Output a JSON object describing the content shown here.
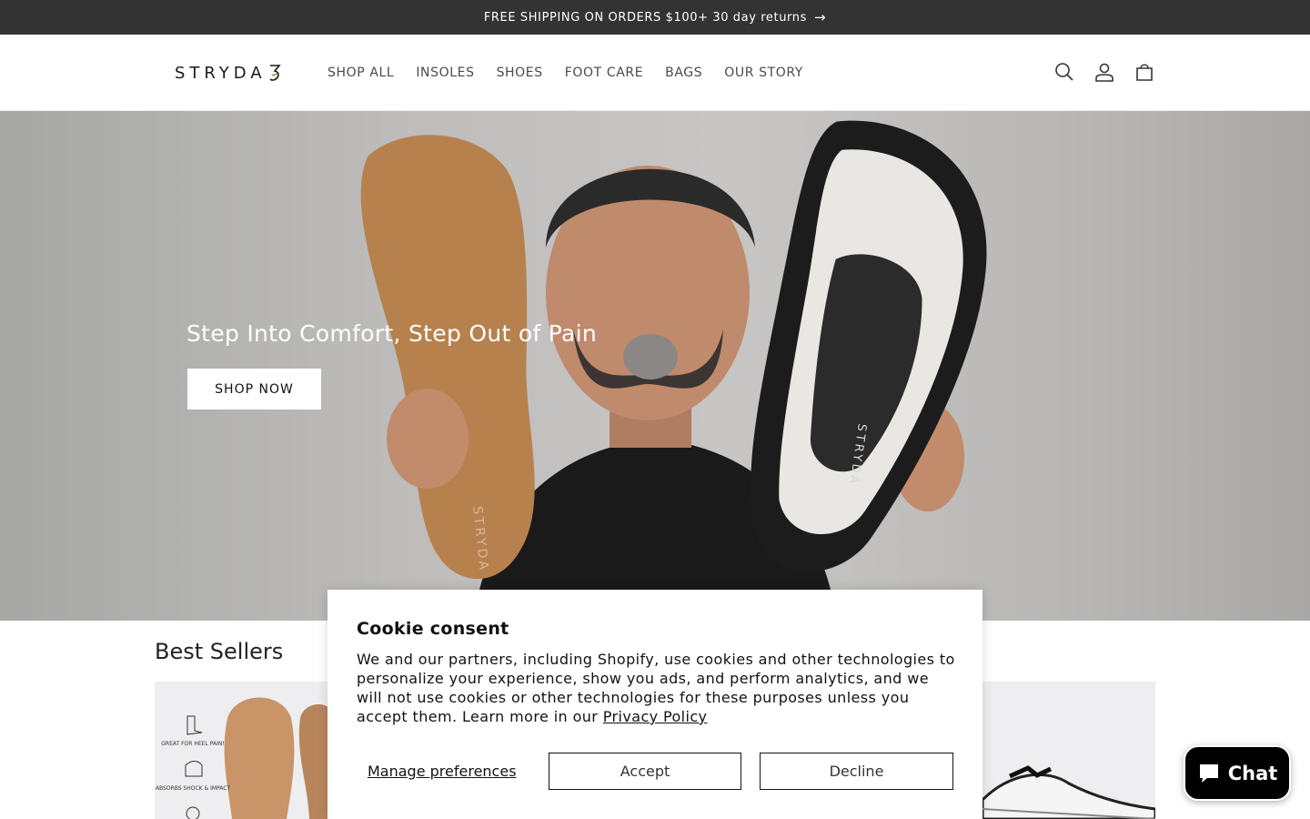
{
  "announcement": {
    "text": "FREE SHIPPING ON ORDERS $100+ 30 day returns",
    "arrow": "→"
  },
  "header": {
    "logo_text": "STRYDA",
    "nav": [
      "SHOP ALL",
      "INSOLES",
      "SHOES",
      "FOOT CARE",
      "BAGS",
      "OUR STORY"
    ],
    "icons": [
      "search-icon",
      "account-icon",
      "cart-icon"
    ]
  },
  "hero": {
    "title": "Step Into Comfort, Step Out of Pain",
    "button": "SHOP NOW",
    "insole_brand": "STRYDA",
    "shoe_brand": "STRYDA"
  },
  "best_sellers": {
    "title": "Best Sellers",
    "product1_features": [
      "GREAT FOR HEEL PAIN!",
      "ABSORBS SHOCK & IMPACT"
    ]
  },
  "cookie": {
    "title": "Cookie consent",
    "body": "We and our partners, including Shopify, use cookies and other technologies to personalize your experience, show you ads, and perform analytics, and we will not use cookies or other technologies for these purposes unless you accept them. Learn more in our ",
    "link": "Privacy Policy",
    "manage": "Manage preferences",
    "accept": "Accept",
    "decline": "Decline"
  },
  "chat": {
    "label": "Chat"
  },
  "colors": {
    "announcement_bg": "#333333",
    "chat_bg": "#000000",
    "logo_accent": "#7aa03c"
  }
}
